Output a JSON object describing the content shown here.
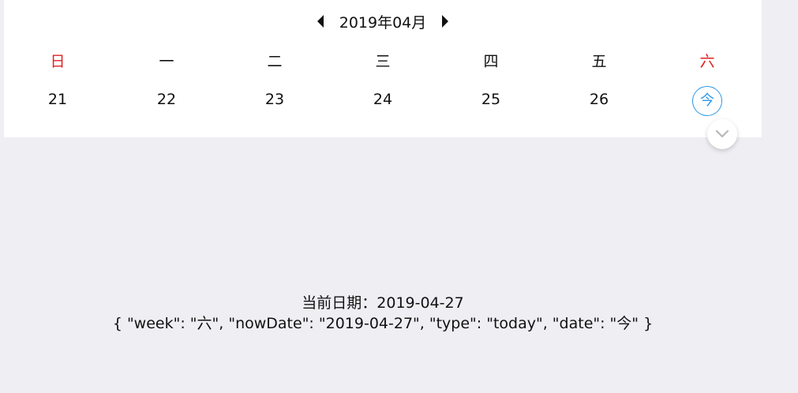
{
  "calendar": {
    "month_label": "2019年04月",
    "weekdays": [
      "日",
      "一",
      "二",
      "三",
      "四",
      "五",
      "六"
    ],
    "days": [
      "21",
      "22",
      "23",
      "24",
      "25",
      "26"
    ],
    "today_label": "今",
    "colors": {
      "weekend": "#e02020",
      "today_accent": "#2d98e8"
    },
    "icons": {
      "prev": "caret-left-icon",
      "next": "caret-right-icon",
      "collapse": "chevron-down-icon"
    }
  },
  "info": {
    "current_date_label": "当前日期：",
    "current_date_value": "2019-04-27",
    "json_text": "{ \"week\": \"六\", \"nowDate\": \"2019-04-27\", \"type\": \"today\", \"date\": \"今\" }"
  }
}
